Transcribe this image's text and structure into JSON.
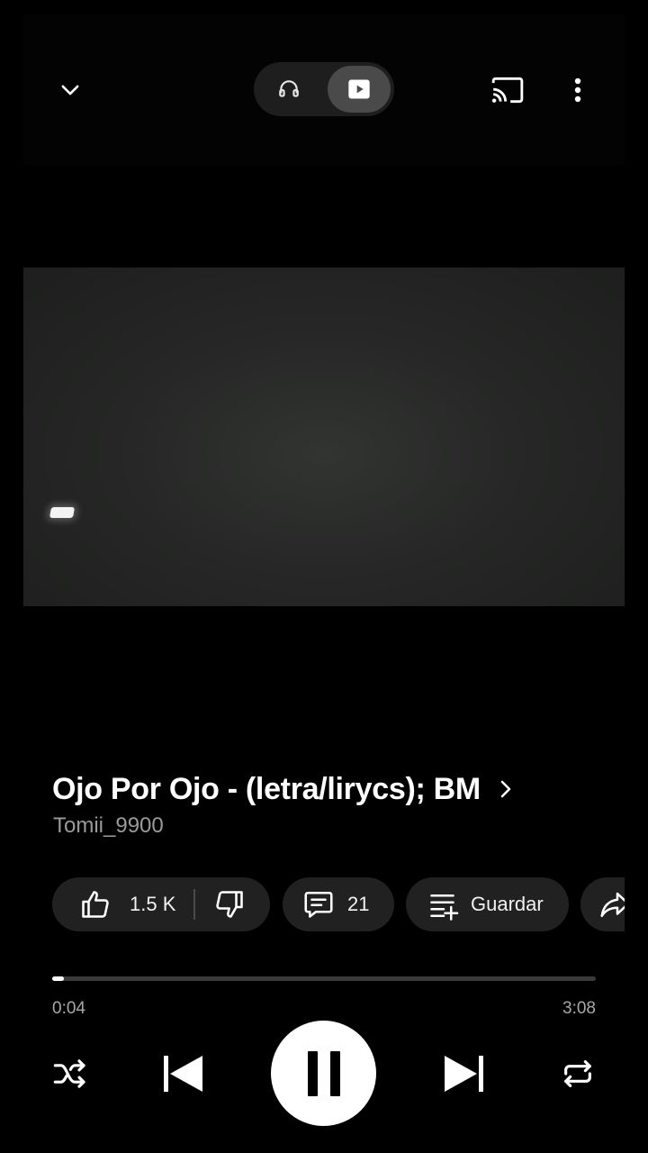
{
  "header": {
    "collapse_icon": "chevron-down-icon",
    "mode_toggle": {
      "options": [
        "audio",
        "video"
      ],
      "selected": "video",
      "audio_icon": "headphones-icon",
      "video_icon": "play-box-icon"
    },
    "cast_icon": "cast-icon",
    "more_icon": "more-vert-icon"
  },
  "song": {
    "title": "Ojo Por Ojo - (letra/lirycs); BM",
    "artist": "Tomii_9900"
  },
  "actions": {
    "like_count": "1.5 K",
    "comments_count": "21",
    "save_label": "Guardar"
  },
  "playback": {
    "current_time": "0:04",
    "total_time": "3:08",
    "progress_fraction": 0.021,
    "state": "playing"
  },
  "colors": {
    "background": "#000000",
    "pill": "#212121",
    "text_secondary": "#9a9a9a",
    "progress_track": "#3a3a3a",
    "progress_fill": "#ffffff"
  }
}
